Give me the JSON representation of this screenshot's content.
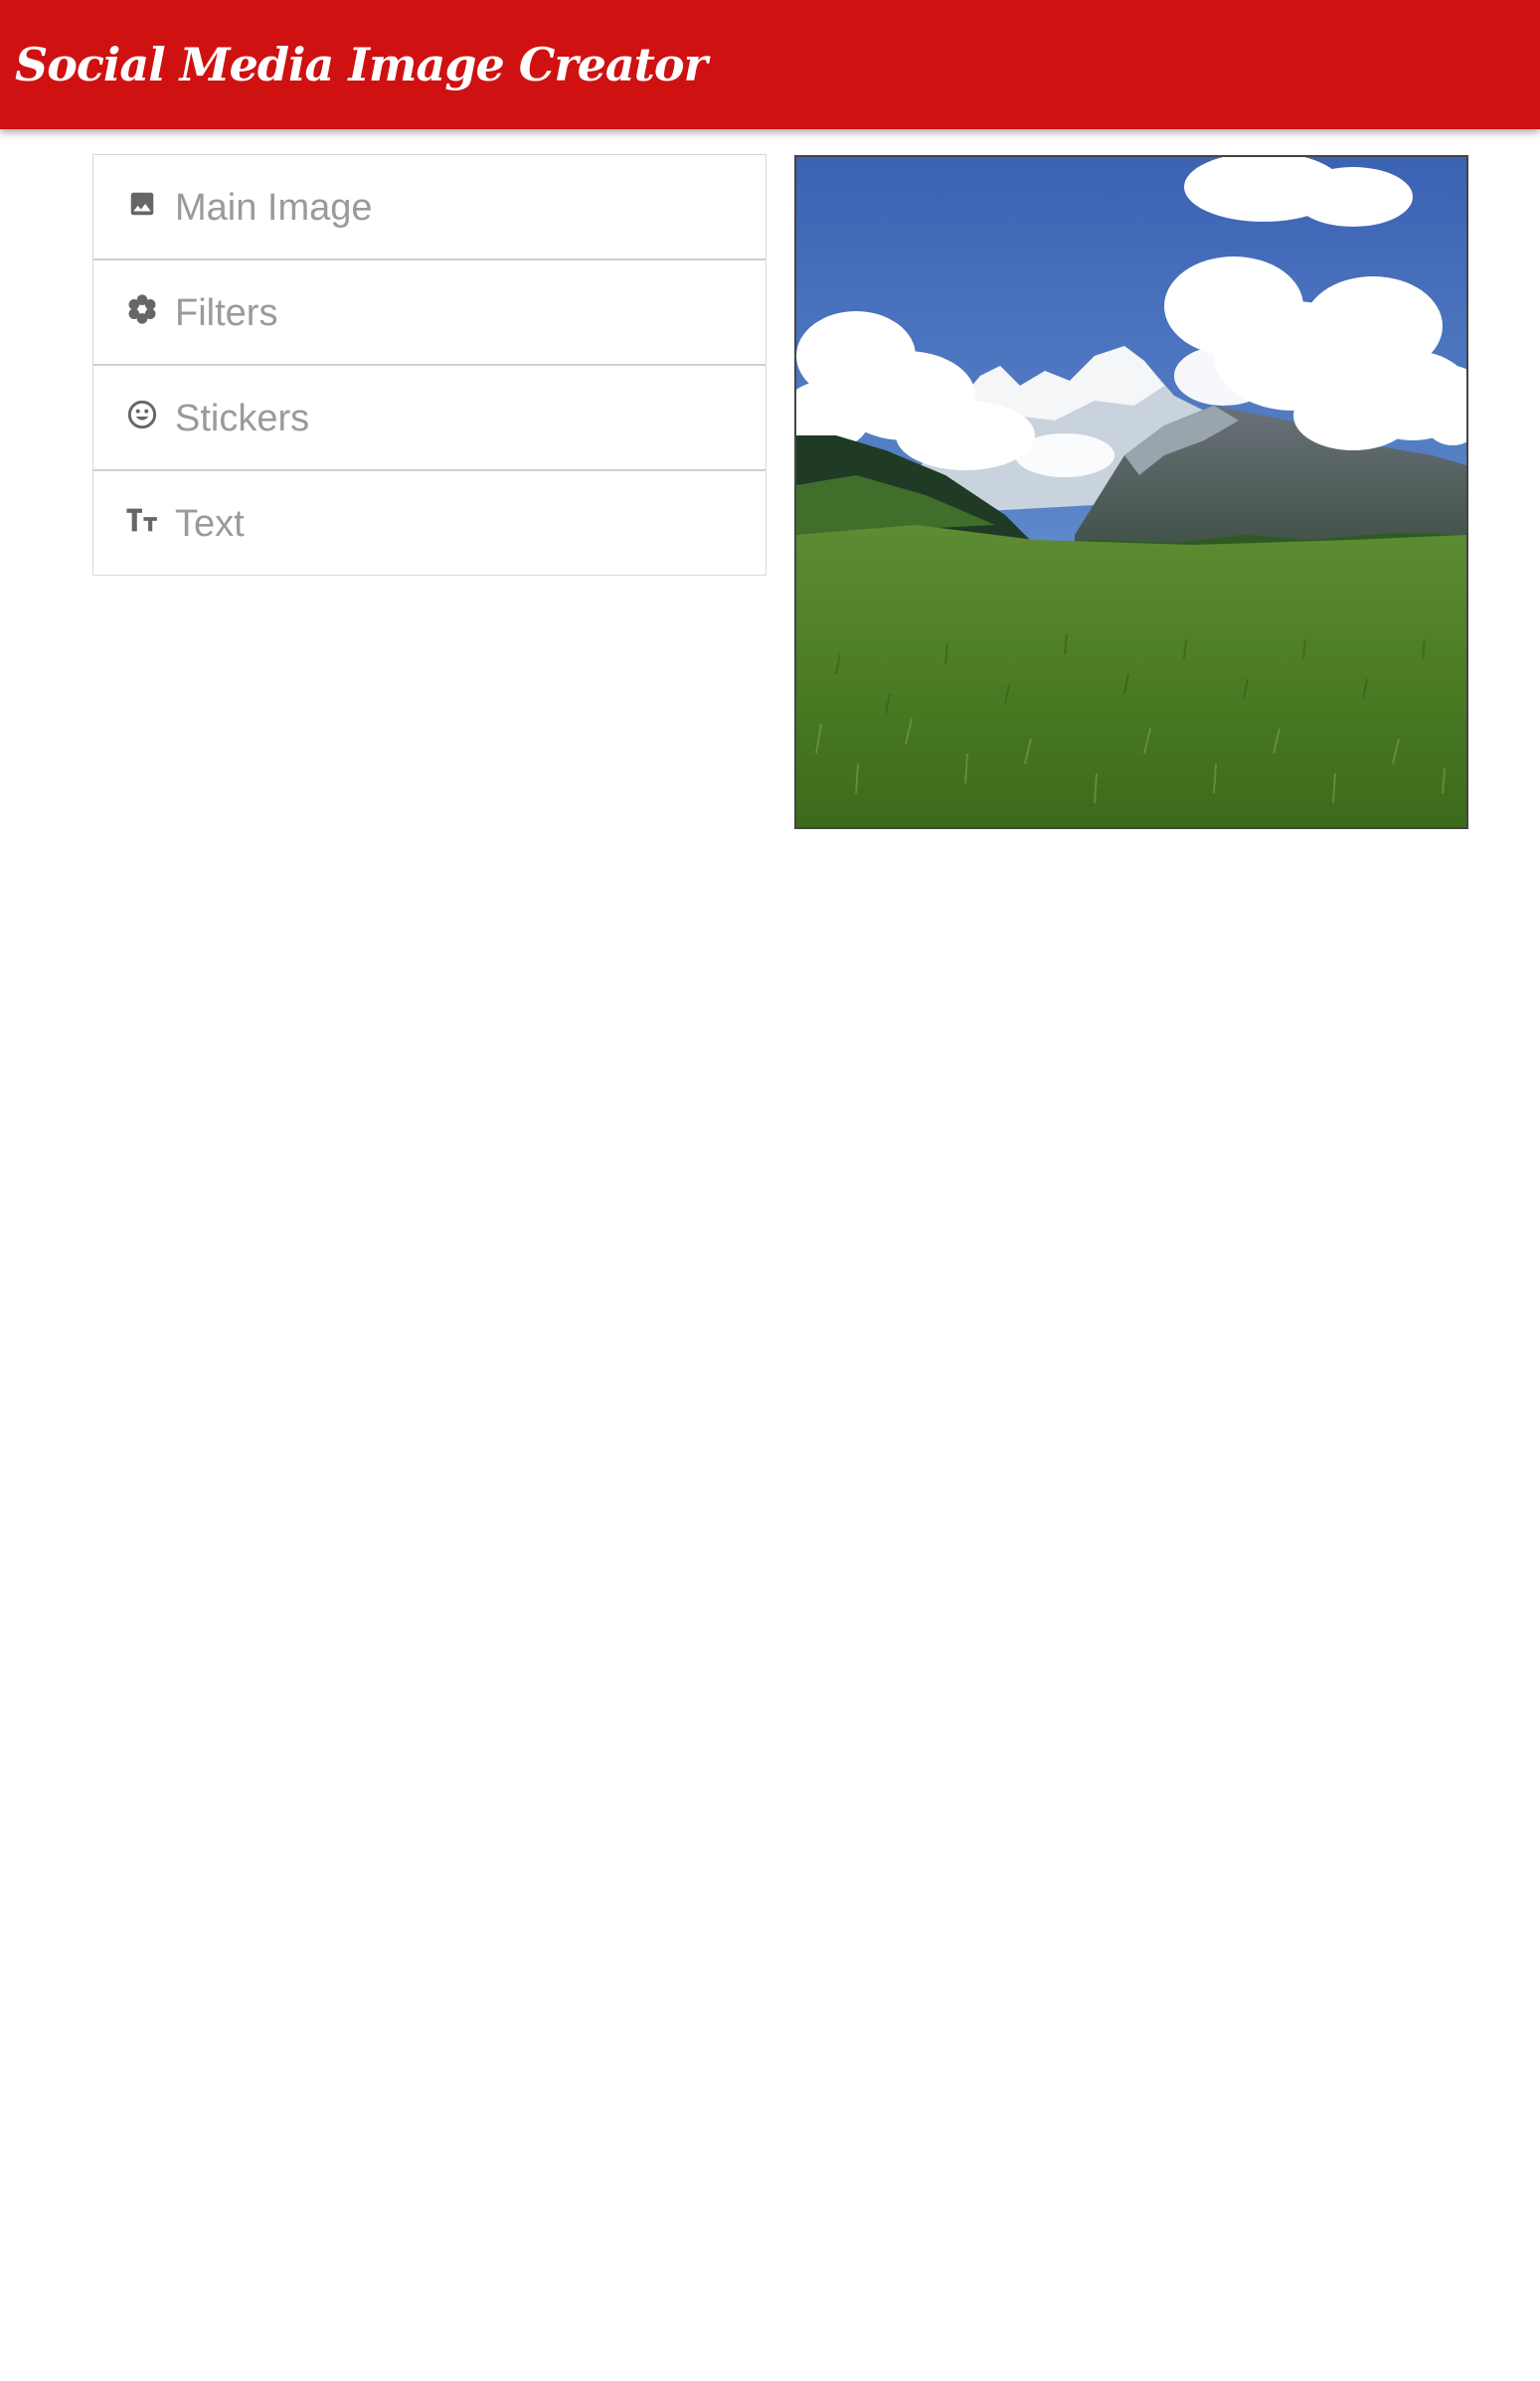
{
  "header": {
    "title": "Social Media Image Creator",
    "background_color": "#cf1111"
  },
  "panel": {
    "items": [
      {
        "label": "Main Image",
        "icon": "image-icon"
      },
      {
        "label": "Filters",
        "icon": "flower-icon"
      },
      {
        "label": "Stickers",
        "icon": "smiley-icon"
      },
      {
        "label": "Text",
        "icon": "text-size-icon"
      }
    ]
  },
  "preview": {
    "icon": "mountain-meadow-photo"
  }
}
